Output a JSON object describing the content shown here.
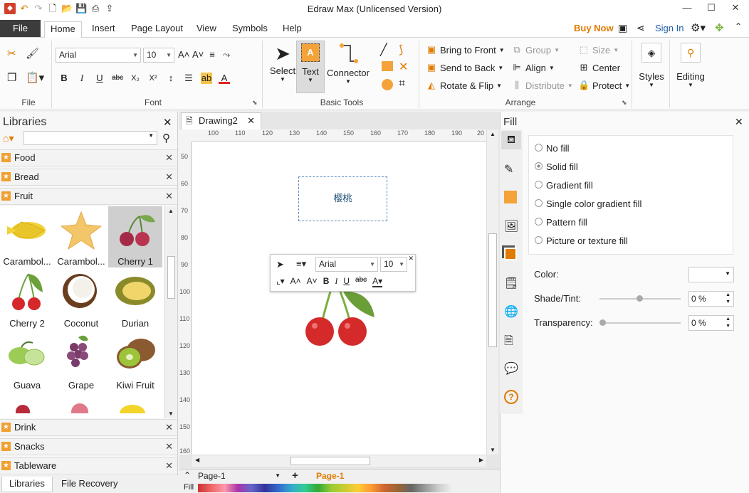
{
  "app": {
    "title": "Edraw Max (Unlicensed Version)"
  },
  "quick_access": [
    "undo-icon",
    "redo-icon",
    "new-icon",
    "open-icon",
    "save-icon",
    "print-icon",
    "export-icon"
  ],
  "window_controls": {
    "minimize": "—",
    "maximize": "☐",
    "close": "✕"
  },
  "tabs": {
    "file": "File",
    "items": [
      "Home",
      "Insert",
      "Page Layout",
      "View",
      "Symbols",
      "Help"
    ],
    "active": "Home"
  },
  "account": {
    "buy_now": "Buy Now",
    "sign_in": "Sign In"
  },
  "ribbon": {
    "file_group": "File",
    "font_group": "Font",
    "basic_tools_group": "Basic Tools",
    "arrange_group": "Arrange",
    "font_name": "Arial",
    "font_size": "10",
    "select": "Select",
    "text": "Text",
    "connector": "Connector",
    "bring_to_front": "Bring to Front",
    "send_to_back": "Send to Back",
    "rotate_flip": "Rotate & Flip",
    "group": "Group",
    "align": "Align",
    "distribute": "Distribute",
    "size": "Size",
    "center": "Center",
    "protect": "Protect",
    "styles": "Styles",
    "editing": "Editing",
    "format_buttons": [
      "B",
      "I",
      "U",
      "abc",
      "X₂",
      "X²"
    ]
  },
  "libraries": {
    "title": "Libraries",
    "search_placeholder": "",
    "categories_top": [
      "Food",
      "Bread",
      "Fruit"
    ],
    "shapes": [
      {
        "label": "Carambol..."
      },
      {
        "label": "Carambol..."
      },
      {
        "label": "Cherry 1"
      },
      {
        "label": "Cherry 2"
      },
      {
        "label": "Coconut"
      },
      {
        "label": "Durian"
      },
      {
        "label": "Guava"
      },
      {
        "label": "Grape"
      },
      {
        "label": "Kiwi Fruit"
      }
    ],
    "categories_bottom": [
      "Drink",
      "Snacks",
      "Tableware"
    ],
    "bottom_tabs": [
      "Libraries",
      "File Recovery"
    ]
  },
  "document": {
    "tab": "Drawing2",
    "hruler": [
      "100",
      "110",
      "120",
      "130",
      "140",
      "150",
      "160",
      "170",
      "180",
      "190",
      "20"
    ],
    "vruler": [
      "50",
      "60",
      "70",
      "80",
      "90",
      "100",
      "110",
      "120",
      "130",
      "140",
      "150",
      "160"
    ],
    "textbox": "樱桃",
    "float_font": "Arial",
    "float_size": "10",
    "page_select": "Page-1",
    "page_tab": "Page-1",
    "fill_label": "Fill"
  },
  "fill_panel": {
    "title": "Fill",
    "options": [
      "No fill",
      "Solid fill",
      "Gradient fill",
      "Single color gradient fill",
      "Pattern fill",
      "Picture or texture fill"
    ],
    "selected": "Solid fill",
    "color_label": "Color:",
    "shade_label": "Shade/Tint:",
    "shade_value": "0 %",
    "transparency_label": "Transparency:",
    "transparency_value": "0 %"
  },
  "colors": {
    "accent": "#f3a33a",
    "link": "#1f5fa8",
    "buy": "#e07b00",
    "filetab": "#3c3c3c"
  }
}
